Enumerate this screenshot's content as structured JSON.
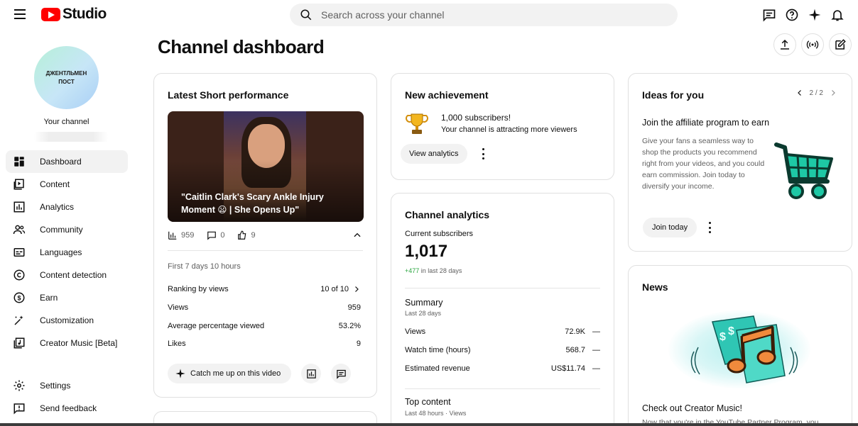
{
  "header": {
    "logo_text": "Studio",
    "search_placeholder": "Search across your channel"
  },
  "sidebar": {
    "avatar_text": "ДЖЕНТЛЬМЕН ПОСТ",
    "your_channel": "Your channel",
    "items": [
      {
        "label": "Dashboard",
        "icon": "dashboard-icon",
        "active": true
      },
      {
        "label": "Content",
        "icon": "content-icon"
      },
      {
        "label": "Analytics",
        "icon": "analytics-icon"
      },
      {
        "label": "Community",
        "icon": "community-icon"
      },
      {
        "label": "Languages",
        "icon": "languages-icon"
      },
      {
        "label": "Content detection",
        "icon": "copyright-icon"
      },
      {
        "label": "Earn",
        "icon": "dollar-icon"
      },
      {
        "label": "Customization",
        "icon": "magic-wand-icon"
      },
      {
        "label": "Creator Music [Beta]",
        "icon": "music-icon"
      },
      {
        "label": "Settings",
        "icon": "gear-icon"
      },
      {
        "label": "Send feedback",
        "icon": "feedback-icon"
      }
    ]
  },
  "page": {
    "title": "Channel dashboard"
  },
  "latest_short": {
    "title": "Latest Short performance",
    "video_title": "\"Caitlin Clark's Scary Ankle Injury Moment 😦 | She Opens Up\"",
    "views_count": "959",
    "comments_count": "0",
    "likes_count": "9",
    "period": "First 7 days 10 hours",
    "rows": [
      {
        "label": "Ranking by views",
        "value": "10 of 10"
      },
      {
        "label": "Views",
        "value": "959"
      },
      {
        "label": "Average percentage viewed",
        "value": "53.2%"
      },
      {
        "label": "Likes",
        "value": "9"
      }
    ],
    "catch_up_label": "Catch me up on this video"
  },
  "achievement": {
    "title": "New achievement",
    "headline": "1,000 subscribers!",
    "subtext": "Your channel is attracting more viewers",
    "button": "View analytics"
  },
  "analytics": {
    "title": "Channel analytics",
    "subs_label": "Current subscribers",
    "subs_value": "1,017",
    "subs_delta": "+477",
    "subs_delta_period": "in last 28 days",
    "summary_title": "Summary",
    "summary_period": "Last 28 days",
    "rows": [
      {
        "label": "Views",
        "value": "72.9K",
        "trend": "—"
      },
      {
        "label": "Watch time (hours)",
        "value": "568.7",
        "trend": "—"
      },
      {
        "label": "Estimated revenue",
        "value": "US$11.74",
        "trend": "—"
      }
    ],
    "top_content_title": "Top content",
    "top_content_period": "Last 48 hours · Views"
  },
  "ideas": {
    "title": "Ideas for you",
    "pager": "2 / 2",
    "headline": "Join the affiliate program to earn",
    "body": "Give your fans a seamless way to shop the products you recommend right from your videos, and you could earn commission. Join today to diversify your income.",
    "button": "Join today"
  },
  "news": {
    "title": "News",
    "headline": "Check out Creator Music!",
    "body": "Now that you're in the YouTube Partner Program, you"
  },
  "colors": {
    "brand_red": "#ff0000",
    "positive_green": "#2ba640",
    "cart_teal": "#1ec8a5"
  }
}
